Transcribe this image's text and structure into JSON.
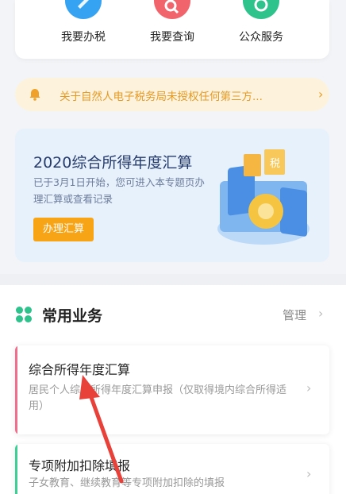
{
  "services": [
    {
      "label": "我要办税",
      "icon": "pen-icon",
      "color": "#36a2f2"
    },
    {
      "label": "我要查询",
      "icon": "search-icon",
      "color": "#f2646b"
    },
    {
      "label": "公众服务",
      "icon": "public-service-icon",
      "color": "#2ec28c"
    }
  ],
  "notice": {
    "text": "关于自然人电子税务局未授权任何第三方..."
  },
  "banner": {
    "title": "2020综合所得年度汇算",
    "description": "已于3月1日开始，您可进入本专题页办理汇算或查看记录",
    "button": "办理汇算",
    "badge": "税"
  },
  "common_business": {
    "title": "常用业务",
    "manage": "管理",
    "items": [
      {
        "title": "综合所得年度汇算",
        "description": "居民个人综合所得年度汇算申报（仅取得境内综合所得适用）",
        "accent": "#f06e8c"
      },
      {
        "title": "专项附加扣除填报",
        "description": "子女教育、继续教育等专项附加扣除的填报",
        "accent": "#3ecf95"
      }
    ]
  },
  "colors": {
    "notice_text": "#e59a25",
    "button": "#f7a417",
    "annotation_arrow": "#e8413a"
  }
}
